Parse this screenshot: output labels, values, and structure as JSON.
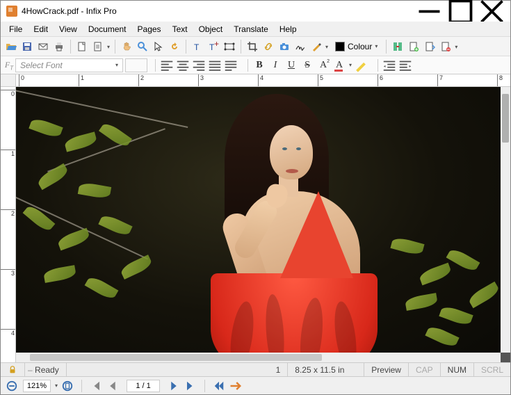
{
  "title": "4HowCrack.pdf - Infix Pro",
  "menu": [
    "File",
    "Edit",
    "View",
    "Document",
    "Pages",
    "Text",
    "Object",
    "Translate",
    "Help"
  ],
  "toolbar": {
    "colour_label": "Colour"
  },
  "format": {
    "font_placeholder": "Select Font"
  },
  "ruler_h": [
    "0",
    "1",
    "2",
    "3",
    "4",
    "5",
    "6",
    "7",
    "8"
  ],
  "ruler_v": [
    "0",
    "1",
    "2",
    "3",
    "4"
  ],
  "info": {
    "status": "Ready",
    "page": "1",
    "dims": "8.25 x 11.5 in",
    "preview": "Preview",
    "caps": "CAP",
    "num": "NUM",
    "scrl": "SCRL"
  },
  "nav": {
    "zoom": "121%",
    "page": "1 / 1"
  }
}
